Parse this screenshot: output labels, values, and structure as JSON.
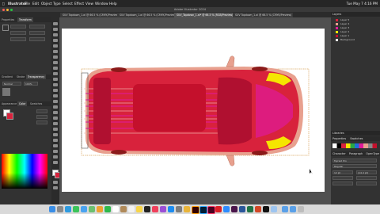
{
  "menubar": {
    "items": [
      "Illustrator",
      "File",
      "Edit",
      "Object",
      "Type",
      "Select",
      "Effect",
      "View",
      "Window",
      "Help"
    ],
    "clock": "Tue May 7  4:16 PM"
  },
  "window": {
    "title": "Adobe Illustrator 2024"
  },
  "doc_tabs": [
    {
      "label": "SUV Topdown_1.ai @ 66.5 % (CMYK/Preview)",
      "active": false
    },
    {
      "label": "SUV Topdown_1.ai @ 66.5 % (CMYK/Preview)",
      "active": false
    },
    {
      "label": "SUV_Topdown_1.ai* @ 66.5 % (RGB/Preview)",
      "active": true
    },
    {
      "label": "SUV Topdown_1.ai @ 66.5 % (CMYK/Preview)",
      "active": false
    }
  ],
  "left_panel": {
    "top_tabs": [
      "Properties",
      "Transform"
    ],
    "mid_tabs": [
      "Gradient",
      "Stroke",
      "Transparency"
    ],
    "lower_tabs": [
      "Appearance",
      "Color",
      "Swatches"
    ],
    "blend_mode": "Normal",
    "opacity": "100%"
  },
  "right_panel": {
    "layers_header": "Layers",
    "layers": [
      "Layer 5",
      "Layer 4",
      "Layer 3",
      "Layer 2",
      "Layer 1",
      "Background"
    ],
    "libraries_header": "Libraries",
    "props_tabs": [
      "Properties",
      "Swatches"
    ],
    "character_tabs": [
      "Character",
      "Paragraph",
      "OpenType"
    ],
    "font": "Myriad Pro",
    "style": "Regular",
    "size": "12 pt",
    "leading": "(14.4 pt)"
  },
  "colors": {
    "body": "#d8223c",
    "roof": "#c4102c",
    "pink": "#e8a08e",
    "magenta": "#e01a9a",
    "yellow": "#f5e600",
    "tan_border": "#d9a25a"
  },
  "dock_count": 32
}
